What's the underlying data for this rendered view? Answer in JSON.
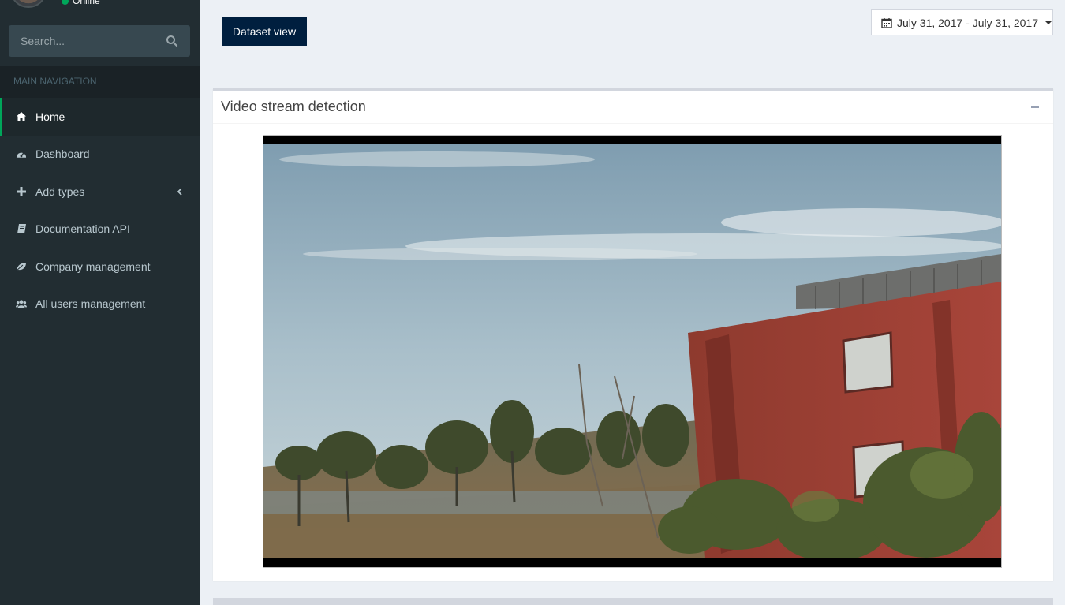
{
  "sidebar": {
    "user": {
      "status": "Online",
      "status_color": "#00a65a"
    },
    "search": {
      "placeholder": "Search..."
    },
    "nav_header": "MAIN NAVIGATION",
    "items": [
      {
        "label": "Home",
        "icon": "home-icon",
        "active": true
      },
      {
        "label": "Dashboard",
        "icon": "dashboard-icon"
      },
      {
        "label": "Add types",
        "icon": "plus-icon",
        "has_submenu": true
      },
      {
        "label": "Documentation API",
        "icon": "book-icon"
      },
      {
        "label": "Company management",
        "icon": "leaf-icon"
      },
      {
        "label": "All users management",
        "icon": "users-icon"
      }
    ]
  },
  "toolbar": {
    "dataset_view_label": "Dataset view",
    "daterange": "July 31, 2017 - July 31, 2017"
  },
  "box": {
    "title": "Video stream detection"
  },
  "colors": {
    "sidebar_bg": "#222d32",
    "accent_green": "#00a65a",
    "button_navy": "#001f3f",
    "content_bg": "#ecf0f5"
  }
}
